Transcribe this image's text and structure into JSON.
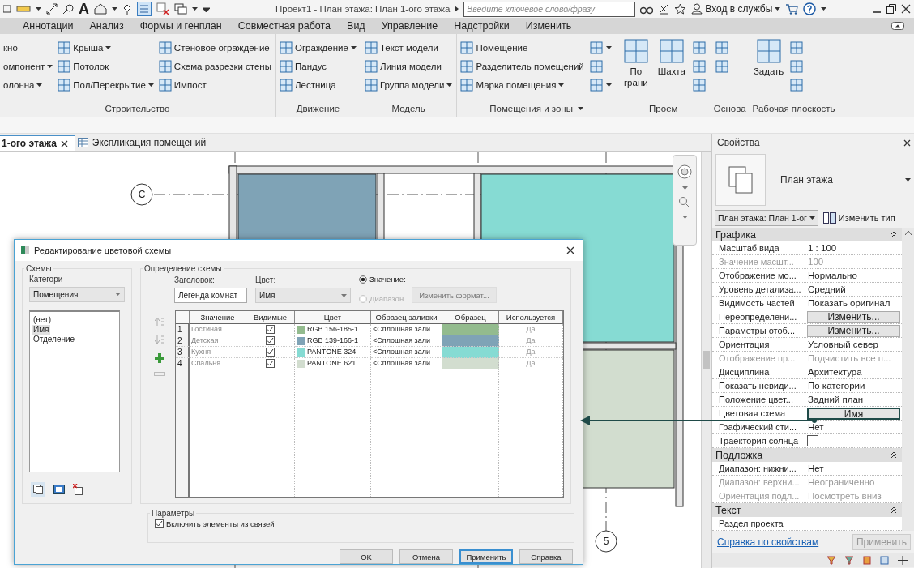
{
  "title_bar": {
    "text_tool": "A",
    "title": "Проект1 - План этажа: План 1-ого этажа",
    "search": {
      "placeholder": "Введите ключевое слово/фразу"
    },
    "sign_in": "Вход в службы"
  },
  "menu_tabs": [
    {
      "label": "Аннотации",
      "selected": false
    },
    {
      "label": "Анализ",
      "selected": false
    },
    {
      "label": "Формы и генплан",
      "selected": false
    },
    {
      "label": "Совместная работа",
      "selected": false
    },
    {
      "label": "Вид",
      "selected": false
    },
    {
      "label": "Управление",
      "selected": false
    },
    {
      "label": "Надстройки",
      "selected": false
    },
    {
      "label": "Изменить",
      "selected": false
    }
  ],
  "ribbon": {
    "panels": [
      {
        "title": "Строительство",
        "dropdown": false,
        "columns": [
          {
            "kind": "text-list",
            "items": [
              {
                "label": "кно",
                "dropdown": false
              },
              {
                "label": "омпонент",
                "dropdown": true
              },
              {
                "label": "олонна",
                "dropdown": true
              }
            ]
          },
          {
            "kind": "list",
            "items": [
              {
                "label": "Крыша",
                "dropdown": true
              },
              {
                "label": "Потолок",
                "dropdown": false
              },
              {
                "label": "Пол/Перекрытие",
                "dropdown": true
              }
            ]
          },
          {
            "kind": "list",
            "items": [
              {
                "label": "Стеновое ограждение",
                "dropdown": false
              },
              {
                "label": "Схема разрезки стены",
                "dropdown": false
              },
              {
                "label": "Импост",
                "dropdown": false
              }
            ]
          }
        ]
      },
      {
        "title": "Движение",
        "dropdown": false,
        "columns": [
          {
            "kind": "list",
            "items": [
              {
                "label": "Ограждение",
                "dropdown": true
              },
              {
                "label": "Пандус",
                "dropdown": false
              },
              {
                "label": "Лестница",
                "dropdown": false
              }
            ]
          }
        ]
      },
      {
        "title": "Модель",
        "dropdown": false,
        "columns": [
          {
            "kind": "list",
            "items": [
              {
                "label": "Текст модели",
                "dropdown": false
              },
              {
                "label": "Линия модели",
                "dropdown": false
              },
              {
                "label": "Группа модели",
                "dropdown": true
              }
            ]
          }
        ]
      },
      {
        "title": "Помещения и зоны",
        "dropdown": true,
        "columns": [
          {
            "kind": "list",
            "items": [
              {
                "label": "Помещение",
                "dropdown": false
              },
              {
                "label": "Разделитель помещений",
                "dropdown": false
              },
              {
                "label": "Марка помещения",
                "dropdown": true
              }
            ]
          },
          {
            "kind": "list",
            "items": [
              {
                "dropdown": true
              },
              {
                "dropdown": false
              },
              {
                "dropdown": true
              }
            ]
          }
        ]
      },
      {
        "title": "Проем",
        "dropdown": false,
        "columns": [
          {
            "kind": "large",
            "label": "По грани"
          },
          {
            "kind": "large",
            "label": "Шахта"
          },
          {
            "kind": "list",
            "items": [
              {
                "dropdown": false
              },
              {
                "dropdown": false
              },
              {
                "dropdown": false
              }
            ]
          }
        ]
      },
      {
        "title": "Основа",
        "dropdown": false,
        "columns": [
          {
            "kind": "list",
            "items": [
              {
                "dropdown": false
              },
              {
                "dropdown": false
              }
            ]
          }
        ]
      },
      {
        "title": "Рабочая плоскость",
        "dropdown": false,
        "columns": [
          {
            "kind": "large",
            "label": "Задать"
          },
          {
            "kind": "list",
            "items": [
              {
                "dropdown": false
              },
              {
                "dropdown": false
              },
              {
                "dropdown": false
              }
            ]
          }
        ]
      }
    ]
  },
  "view_tabs": [
    {
      "label": "1-ого этажа",
      "selected": true,
      "closable": true
    },
    {
      "label": "Экспликация помещений",
      "selected": false,
      "closable": false
    }
  ],
  "canvas": {
    "grid_bubbles": [
      {
        "label": "C"
      },
      {
        "label": "5"
      }
    ]
  },
  "dialog": {
    "title": "Редактирование цветовой схемы",
    "schemes": {
      "title": "Схемы",
      "category_label": "Категори",
      "category": "Помещения",
      "items": [
        {
          "label": "(нет)",
          "selected": false
        },
        {
          "label": "Имя",
          "selected": true
        },
        {
          "label": "Отделение",
          "selected": false
        }
      ]
    },
    "definition": {
      "title": "Определение схемы",
      "heading_label": "Заголовок:",
      "heading": "Легенда комнат",
      "color_label": "Цвет:",
      "color_by": "Имя",
      "modes": [
        {
          "label": "Значение:",
          "selected": true,
          "disabled": false
        },
        {
          "label": "Диапазон",
          "selected": false,
          "disabled": true
        }
      ],
      "format_button": {
        "label": "Изменить формат...",
        "disabled": true
      },
      "columns": [
        "Значение",
        "Видимые",
        "Цвет",
        "Образец заливки",
        "Образец",
        "Используется"
      ],
      "rows": [
        {
          "number": "1",
          "value": "Гостиная",
          "visible": true,
          "color_name": "RGB 156-185-1",
          "color": "#93bb8e",
          "fill": "<Сплошная зали",
          "used": "Да"
        },
        {
          "number": "2",
          "value": "Детская",
          "visible": true,
          "color_name": "RGB 139-166-1",
          "color": "#7fa3b6",
          "fill": "<Сплошная зали",
          "used": "Да"
        },
        {
          "number": "3",
          "value": "Кухня",
          "visible": true,
          "color_name": "PANTONE 324",
          "color": "#86dbd3",
          "fill": "<Сплошная зали",
          "used": "Да"
        },
        {
          "number": "4",
          "value": "Спальня",
          "visible": true,
          "color_name": "PANTONE 621",
          "color": "#d2ddcf",
          "fill": "<Сплошная зали",
          "used": "Да"
        }
      ]
    },
    "options": {
      "title": "Параметры",
      "include_links": {
        "label": "Включить элементы из связей",
        "checked": true
      }
    },
    "buttons": [
      {
        "label": "OK",
        "default": false
      },
      {
        "label": "Отмена",
        "default": false
      },
      {
        "label": "Применить",
        "default": true
      },
      {
        "label": "Справка",
        "default": false
      }
    ]
  },
  "properties": {
    "title": "Свойства",
    "type_name": "План этажа",
    "view_selector": "План этажа: План 1-ог",
    "edit_type": "Изменить тип",
    "groups": [
      {
        "title": "Графика",
        "rows": [
          {
            "name": "Масштаб вида",
            "kind": "text",
            "value": "1 : 100",
            "disabled": false
          },
          {
            "name": "Значение масшт...",
            "kind": "text",
            "value": "100",
            "disabled": true
          },
          {
            "name": "Отображение мо...",
            "kind": "text",
            "value": "Нормально",
            "disabled": false
          },
          {
            "name": "Уровень детализа...",
            "kind": "text",
            "value": "Средний",
            "disabled": false
          },
          {
            "name": "Видимость частей",
            "kind": "text",
            "value": "Показать оригинал",
            "disabled": false
          },
          {
            "name": "Переопределени...",
            "kind": "button",
            "value": "Изменить...",
            "highlighted": false,
            "disabled": false
          },
          {
            "name": "Параметры отоб...",
            "kind": "button",
            "value": "Изменить...",
            "highlighted": false,
            "disabled": false
          },
          {
            "name": "Ориентация",
            "kind": "text",
            "value": "Условный север",
            "disabled": false
          },
          {
            "name": "Отображение пр...",
            "kind": "text",
            "value": "Подчистить все п...",
            "disabled": true
          },
          {
            "name": "Дисциплина",
            "kind": "text",
            "value": "Архитектура",
            "disabled": false
          },
          {
            "name": "Показать невиди...",
            "kind": "text",
            "value": "По категории",
            "disabled": false
          },
          {
            "name": "Положение цвет...",
            "kind": "text",
            "value": "Задний план",
            "disabled": false
          },
          {
            "name": "Цветовая схема",
            "kind": "button",
            "value": "Имя",
            "highlighted": true,
            "disabled": false
          },
          {
            "name": "Графический сти...",
            "kind": "text",
            "value": "Нет",
            "disabled": false
          },
          {
            "name": "Траектория солнца",
            "kind": "checkbox",
            "checked": false,
            "disabled": false
          }
        ]
      },
      {
        "title": "Подложка",
        "rows": [
          {
            "name": "Диапазон: нижни...",
            "kind": "text",
            "value": "Нет",
            "disabled": false
          },
          {
            "name": "Диапазон: верхни...",
            "kind": "text",
            "value": "Неограниченно",
            "disabled": true
          },
          {
            "name": "Ориентация подл...",
            "kind": "text",
            "value": "Посмотреть вниз",
            "disabled": true
          }
        ]
      },
      {
        "title": "Текст",
        "rows": [
          {
            "name": "Раздел проекта",
            "kind": "text",
            "disabled": false
          }
        ]
      }
    ],
    "help_link": "Справка по свойствам",
    "apply": {
      "label": "Применить",
      "disabled": true
    }
  }
}
